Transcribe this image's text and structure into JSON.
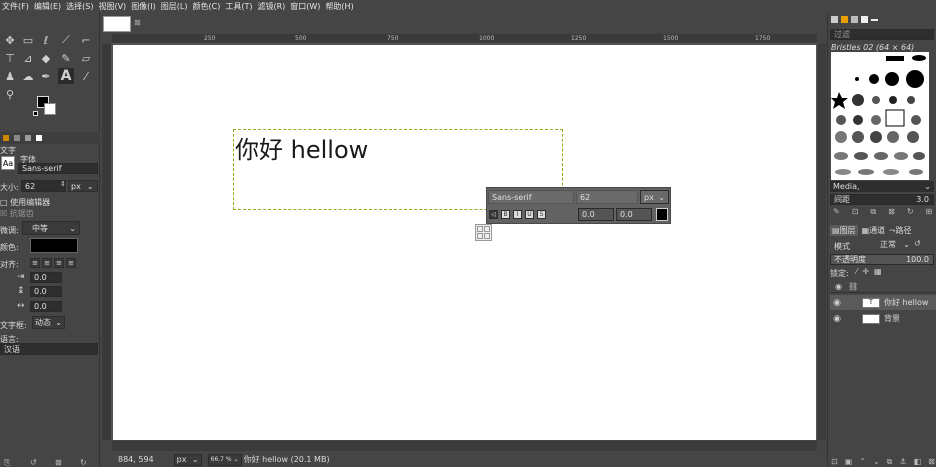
{
  "menu": [
    "文件(F)",
    "编辑(E)",
    "选择(S)",
    "视图(V)",
    "图像(I)",
    "图层(L)",
    "颜色(C)",
    "工具(T)",
    "滤镜(R)",
    "窗口(W)",
    "帮助(H)"
  ],
  "ruler_ticks": [
    "250",
    "500",
    "750",
    "1000",
    "1250",
    "1500",
    "1750"
  ],
  "tool_options": {
    "title": "文字",
    "font_label": "字体",
    "font_value": "Sans-serif",
    "font_badge": "Aa",
    "size_label": "大小:",
    "size_value": "62",
    "size_unit": "px",
    "use_editor": "使用编辑器",
    "antialias": "抗锯齿",
    "hinting_label": "微调:",
    "hinting_value": "中等",
    "color_label": "颜色:",
    "justify_label": "对齐:",
    "indent_value": "0.0",
    "line_spacing_value": "0.0",
    "letter_spacing_value": "0.0",
    "box_label": "文字框:",
    "box_value": "动态",
    "language_label": "语言:",
    "language_value": "汉语"
  },
  "canvas": {
    "text": "你好 hellow"
  },
  "floating_editor": {
    "font": "Sans-serif",
    "size": "62",
    "unit": "px",
    "baseline": "0.0",
    "kerning": "0.0"
  },
  "status": {
    "coords": "884, 594",
    "unit": "px",
    "zoom": "66.7 %",
    "info": "你好 hellow (20.1 MB)"
  },
  "right_panel": {
    "filter_placeholder": "过滤",
    "brush_name": "Bristles 02 (64 × 64)",
    "brush_tag": "Media,",
    "spacing_label": "间距",
    "spacing_value": "3.0",
    "tabs": [
      "图层",
      "通道",
      "路径"
    ],
    "mode_label": "模式",
    "mode_value": "正常",
    "opacity_label": "不透明度",
    "opacity_value": "100.0",
    "lock_label": "锁定:",
    "layers": [
      {
        "name": "你好 hellow",
        "type": "text"
      },
      {
        "name": "背景",
        "type": "image"
      }
    ]
  },
  "colors": {
    "panel_bg": "#454545",
    "canvas_bg": "#ffffff",
    "textbox_border": "#9aa61a"
  }
}
